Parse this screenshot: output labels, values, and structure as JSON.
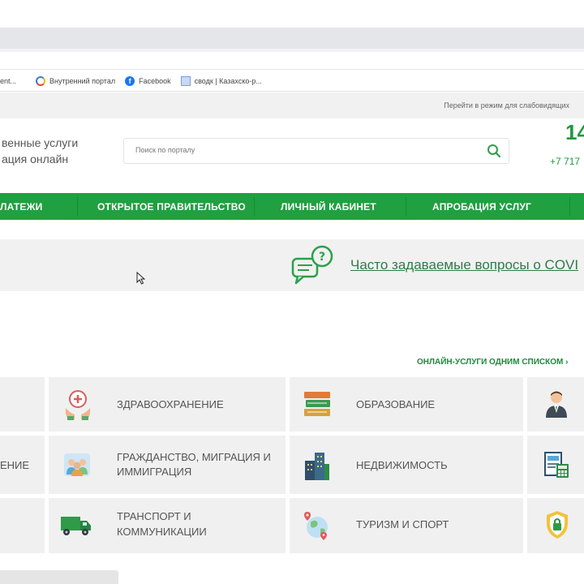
{
  "bookmarks": [
    {
      "icon": "page-icon",
      "label": "ent..."
    },
    {
      "icon": "portal-ring-icon",
      "label": "Внутренний портал"
    },
    {
      "icon": "facebook-icon",
      "label": "Facebook"
    },
    {
      "icon": "document-icon",
      "label": "сводк | Казахско-р..."
    }
  ],
  "accessibility_link": "Перейти в режим для слабовидящих",
  "logo": {
    "line1": "венные услуги",
    "line2": "ация онлайн"
  },
  "search": {
    "placeholder": "Поиск по порталу"
  },
  "contact": {
    "short_number": "14",
    "full_number": "+7 717"
  },
  "nav": [
    "ЛАТЕЖИ",
    "ОТКРЫТОЕ ПРАВИТЕЛЬСТВО",
    "ЛИЧНЫЙ КАБИНЕТ",
    "АПРОБАЦИЯ УСЛУГ"
  ],
  "banner": {
    "faq_label": "Часто задаваемые вопросы о COVI"
  },
  "all_services_link": "ОНЛАЙН-УСЛУГИ ОДНИМ СПИСКОМ ›",
  "categories": {
    "left_partial": [
      "",
      "ЕНИЕ",
      ""
    ],
    "col1": [
      {
        "icon": "healthcare-icon",
        "label": "Здравоохранение"
      },
      {
        "icon": "citizenship-icon",
        "label_line1": "Гражданство, миграция и",
        "label_line2": "иммиграция"
      },
      {
        "icon": "truck-icon",
        "label_line1": "Транспорт и",
        "label_line2": "коммуникации"
      }
    ],
    "col2": [
      {
        "icon": "books-icon",
        "label": "Образование"
      },
      {
        "icon": "buildings-icon",
        "label": "Недвижимость"
      },
      {
        "icon": "globe-pin-icon",
        "label": "Туризм и спорт"
      }
    ],
    "col3_icons": [
      "person-icon",
      "document-calculator-icon",
      "shield-lock-icon"
    ]
  },
  "colors": {
    "brand_green": "#20a040",
    "text_green": "#1d9a3c",
    "cell_bg": "#f0f0f0"
  }
}
